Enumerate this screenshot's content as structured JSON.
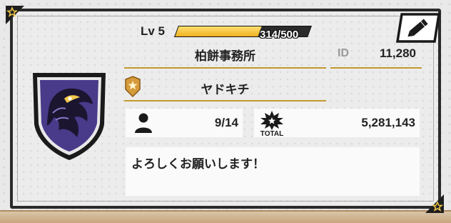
{
  "profile": {
    "level_label": "Lv 5",
    "xp_text": "314/500",
    "xp_progress": 0.628,
    "name": "柏餅事務所",
    "id_label": "ID",
    "id_value": "11,280",
    "title": "ヤドキチ",
    "members": "9/14",
    "total_label": "TOTAL",
    "total_value": "5,281,143",
    "message": "よろしくお願いします！"
  },
  "icons": {
    "edit": "pencil-icon",
    "members": "person-icon",
    "total": "total-burst-icon",
    "badge": "rank-badge-icon",
    "emblem": "bird-shield-emblem",
    "corners": "star-corner-icon"
  },
  "colors": {
    "accent_gold": "#c29a2e",
    "xp_fill": "#f0b020",
    "frame": "#2a2a2a",
    "emblem_purple": "#4a3a8a"
  }
}
